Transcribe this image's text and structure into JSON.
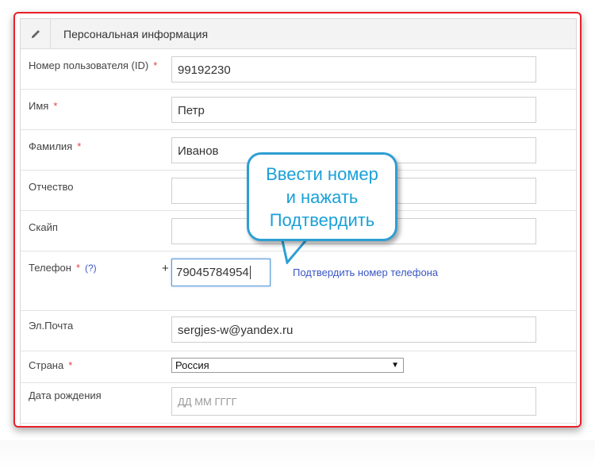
{
  "panel": {
    "title": "Персональная информация"
  },
  "fields": {
    "user_id": {
      "label": "Номер пользователя (ID)",
      "required": "*",
      "value": "99192230"
    },
    "first_name": {
      "label": "Имя",
      "required": "*",
      "value": "Петр"
    },
    "last_name": {
      "label": "Фамилия",
      "required": "*",
      "value": "Иванов"
    },
    "patronymic": {
      "label": "Отчество",
      "value": ""
    },
    "skype": {
      "label": "Скайп",
      "value": ""
    },
    "phone": {
      "label": "Телефон",
      "required": "*",
      "hint": "(?)",
      "prefix": "+",
      "value": "79045784954",
      "confirm_link": "Подтвердить номер телефона"
    },
    "email": {
      "label": "Эл.Почта",
      "value": "sergjes-w@yandex.ru"
    },
    "country": {
      "label": "Страна",
      "required": "*",
      "value": "Россия"
    },
    "birthdate": {
      "label": "Дата рождения",
      "placeholder": "ДД ММ ГГГГ"
    }
  },
  "callout": {
    "line1": "Ввести номер",
    "line2": "и нажать",
    "line3": "Подтвердить"
  },
  "colors": {
    "frame": "#e8202a",
    "callout": "#2d9fd3",
    "link": "#3a57c4",
    "required": "#e0454a"
  },
  "icons": {
    "header": "pencil-icon",
    "select": "caret-down-icon"
  }
}
